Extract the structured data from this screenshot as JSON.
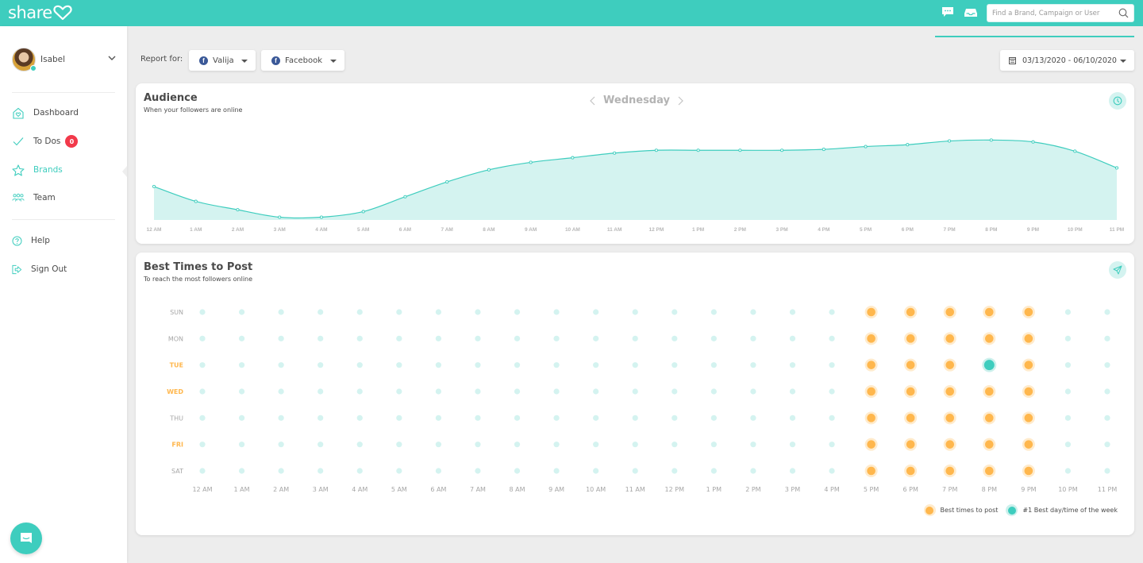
{
  "app": {
    "logo_text": "share",
    "search": {
      "placeholder": "Find a Brand, Campaign or User",
      "value": ""
    },
    "topbar_icons": [
      "chat-bubble-icon",
      "inbox-icon",
      "search-icon"
    ]
  },
  "colors": {
    "brand": "#3ecdbe",
    "brand_light": "#d4f3f0",
    "best_time": "#ffb74d",
    "best_time_halo": "#ffebcc",
    "top_time": "#3ecdbe",
    "top_time_halo": "#ccf0ec",
    "badge": "#f2394a",
    "facebook": "#3b5998",
    "weekday_highlight": "#ffb74d",
    "weekday_normal": "#a6a6a6"
  },
  "sidebar": {
    "user": {
      "name": "Isabel",
      "status": "online"
    },
    "items": [
      {
        "label": "Dashboard",
        "icon": "home-heart-icon",
        "active": false
      },
      {
        "label": "To Dos",
        "icon": "check-icon",
        "active": false,
        "badge": "0"
      },
      {
        "label": "Brands",
        "icon": "star-icon",
        "active": true
      },
      {
        "label": "Team",
        "icon": "team-icon",
        "active": false
      }
    ],
    "secondary_items": [
      {
        "label": "Help",
        "icon": "help-circle-icon"
      },
      {
        "label": "Sign Out",
        "icon": "sign-out-icon"
      }
    ]
  },
  "filters": {
    "report_for_label": "Report for:",
    "brand": {
      "label": "Valija",
      "icon": "facebook-icon"
    },
    "network": {
      "label": "Facebook",
      "icon": "facebook-icon"
    },
    "date_range": "03/13/2020 - 06/10/2020"
  },
  "audience": {
    "title": "Audience",
    "subtitle": "When your followers are online",
    "day": "Wednesday",
    "icon": "clock-icon"
  },
  "best_times": {
    "title": "Best Times to Post",
    "subtitle": "To reach the most followers online",
    "icon": "paper-plane-icon",
    "legend": {
      "best": "Best times to post",
      "top": "#1 Best day/time of the week"
    }
  },
  "chart_data": [
    {
      "type": "area",
      "title": "Audience",
      "subtitle": "When your followers are online",
      "day": "Wednesday",
      "xlabel": "",
      "ylabel": "",
      "x": [
        "12 AM",
        "1 AM",
        "2 AM",
        "3 AM",
        "4 AM",
        "5 AM",
        "6 AM",
        "7 AM",
        "8 AM",
        "9 AM",
        "10 AM",
        "11 AM",
        "12 PM",
        "1 PM",
        "2 PM",
        "3 PM",
        "4 PM",
        "5 PM",
        "6 PM",
        "7 PM",
        "8 PM",
        "9 PM",
        "10 PM",
        "11 PM"
      ],
      "values": [
        36,
        20,
        11,
        3,
        3,
        9,
        25,
        41,
        54,
        62,
        67,
        72,
        75,
        75,
        75,
        75,
        76,
        79,
        81,
        85,
        86,
        84,
        74,
        56
      ],
      "ylim": [
        0,
        100
      ],
      "grid": false,
      "y_axis_visible": false
    },
    {
      "type": "heatmap",
      "title": "Best Times to Post",
      "subtitle": "To reach the most followers online",
      "rows": [
        "SUN",
        "MON",
        "TUE",
        "WED",
        "THU",
        "FRI",
        "SAT"
      ],
      "highlighted_rows": [
        "TUE",
        "WED",
        "FRI"
      ],
      "columns": [
        "12 AM",
        "1 AM",
        "2 AM",
        "3 AM",
        "4 AM",
        "5 AM",
        "6 AM",
        "7 AM",
        "8 AM",
        "9 AM",
        "10 AM",
        "11 AM",
        "12 PM",
        "1 PM",
        "2 PM",
        "3 PM",
        "4 PM",
        "5 PM",
        "6 PM",
        "7 PM",
        "8 PM",
        "9 PM",
        "10 PM",
        "11 PM"
      ],
      "levels": {
        "0": "normal",
        "1": "best times to post",
        "2": "#1 best day/time of the week"
      },
      "values": [
        [
          0,
          0,
          0,
          0,
          0,
          0,
          0,
          0,
          0,
          0,
          0,
          0,
          0,
          0,
          0,
          0,
          0,
          1,
          1,
          1,
          1,
          1,
          0,
          0
        ],
        [
          0,
          0,
          0,
          0,
          0,
          0,
          0,
          0,
          0,
          0,
          0,
          0,
          0,
          0,
          0,
          0,
          0,
          1,
          1,
          1,
          1,
          1,
          0,
          0
        ],
        [
          0,
          0,
          0,
          0,
          0,
          0,
          0,
          0,
          0,
          0,
          0,
          0,
          0,
          0,
          0,
          0,
          0,
          1,
          1,
          1,
          2,
          1,
          0,
          0
        ],
        [
          0,
          0,
          0,
          0,
          0,
          0,
          0,
          0,
          0,
          0,
          0,
          0,
          0,
          0,
          0,
          0,
          0,
          1,
          1,
          1,
          1,
          1,
          0,
          0
        ],
        [
          0,
          0,
          0,
          0,
          0,
          0,
          0,
          0,
          0,
          0,
          0,
          0,
          0,
          0,
          0,
          0,
          0,
          1,
          1,
          1,
          1,
          1,
          0,
          0
        ],
        [
          0,
          0,
          0,
          0,
          0,
          0,
          0,
          0,
          0,
          0,
          0,
          0,
          0,
          0,
          0,
          0,
          0,
          1,
          1,
          1,
          1,
          1,
          0,
          0
        ],
        [
          0,
          0,
          0,
          0,
          0,
          0,
          0,
          0,
          0,
          0,
          0,
          0,
          0,
          0,
          0,
          0,
          0,
          1,
          1,
          1,
          1,
          1,
          0,
          0
        ]
      ],
      "legend": [
        "Best times to post",
        "#1 Best day/time of the week"
      ],
      "legend_position": "bottom-right"
    }
  ]
}
